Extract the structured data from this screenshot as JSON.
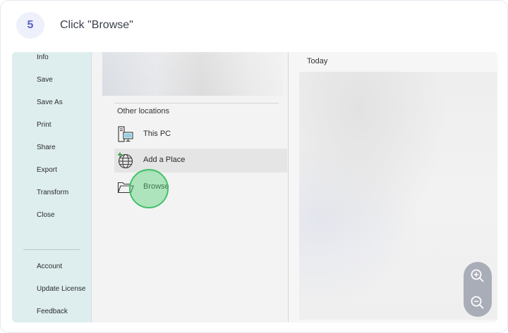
{
  "step": {
    "number": "5",
    "instruction": "Click \"Browse\""
  },
  "sidebar": {
    "items": [
      {
        "label": "Info"
      },
      {
        "label": "Save"
      },
      {
        "label": "Save As"
      },
      {
        "label": "Print"
      },
      {
        "label": "Share"
      },
      {
        "label": "Export"
      },
      {
        "label": "Transform"
      },
      {
        "label": "Close"
      }
    ],
    "footer_items": [
      {
        "label": "Account"
      },
      {
        "label": "Update License"
      },
      {
        "label": "Feedback"
      }
    ]
  },
  "locations": {
    "heading": "Other locations",
    "items": [
      {
        "label": "This PC",
        "icon": "computer-icon"
      },
      {
        "label": "Add a Place",
        "icon": "globe-plus-icon"
      },
      {
        "label": "Browse",
        "icon": "folder-open-icon"
      }
    ]
  },
  "recent": {
    "heading": "Today"
  },
  "colors": {
    "accent": "#5a62c9",
    "sidebar": "#deeeee",
    "click_highlight": "#43c06a"
  }
}
